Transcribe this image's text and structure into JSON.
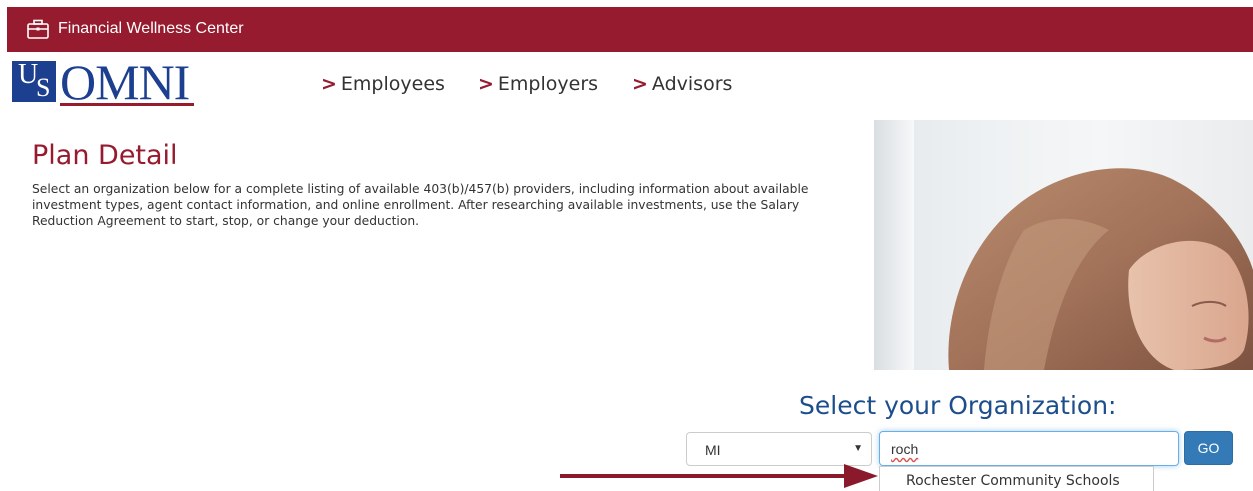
{
  "header": {
    "title": "Financial Wellness Center",
    "icon": "briefcase-icon",
    "bg_color": "#961b2f"
  },
  "logo": {
    "us_u": "U",
    "us_s": "S",
    "omni": "OMNI"
  },
  "nav": {
    "items": [
      {
        "marker": ">",
        "label": "Employees"
      },
      {
        "marker": ">",
        "label": "Employers"
      },
      {
        "marker": ">",
        "label": "Advisors"
      }
    ]
  },
  "plan": {
    "title": "Plan Detail",
    "description": "Select an organization below for a complete listing of available 403(b)/457(b) providers, including information about available investment types, agent contact information, and online enrollment. After researching available investments, use the Salary Reduction Agreement to start, stop, or change your deduction."
  },
  "org_select": {
    "heading": "Select your Organization:",
    "state_value": "MI",
    "search_value": "roch",
    "go_label": "GO",
    "suggestions": [
      "Rochester Community Schools"
    ]
  },
  "colors": {
    "brand_red": "#961b2f",
    "brand_blue": "#1d3f8f",
    "heading_blue": "#1d4e8c",
    "button_blue": "#337ab7"
  }
}
